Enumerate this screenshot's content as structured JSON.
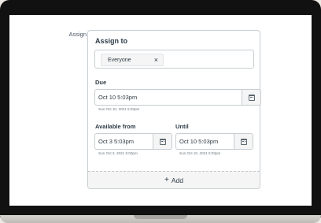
{
  "assign_section": {
    "label": "Assign",
    "card_title": "Assign to",
    "assignee_tag": "Everyone",
    "remove_symbol": "×"
  },
  "due": {
    "label": "Due",
    "value": "Oct 10 5:03pm",
    "hint": "Sun Oct 10, 2021 5:03pm"
  },
  "available_from": {
    "label": "Available from",
    "value": "Oct 3 5:03pm",
    "hint": "Sun Oct 3, 2021 5:03pm"
  },
  "until": {
    "label": "Until",
    "value": "Oct 10 5:03pm",
    "hint": "Sun Oct 10, 2021 5:03pm"
  },
  "add_button": {
    "icon": "plus-icon",
    "symbol": "+",
    "label": "Add"
  },
  "colors": {
    "text": "#2d3b45",
    "border": "#c7cdd1",
    "button_bg": "#f5f5f5"
  }
}
